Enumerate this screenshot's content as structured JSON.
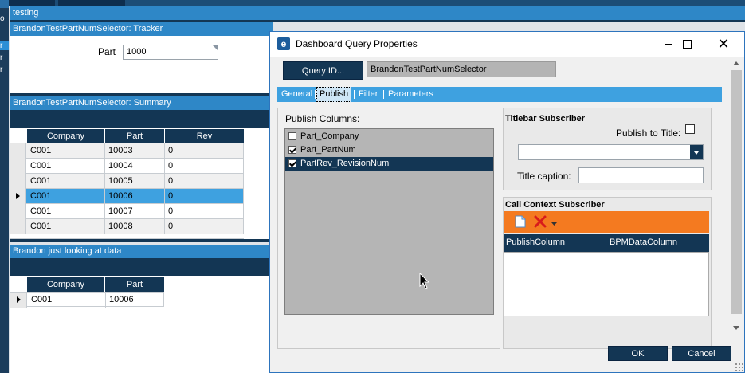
{
  "left_rail": {
    "letters": [
      "o",
      "r",
      "r",
      "r"
    ]
  },
  "panels": {
    "testing_header": "testing",
    "tracker": {
      "header": "BrandonTestPartNumSelector: Tracker",
      "part_label": "Part",
      "part_value": "1000"
    },
    "summary": {
      "header": "BrandonTestPartNumSelector: Summary",
      "columns": [
        "Company",
        "Part",
        "Rev"
      ],
      "rows": [
        [
          "C001",
          "10003",
          "0"
        ],
        [
          "C001",
          "10004",
          "0"
        ],
        [
          "C001",
          "10005",
          "0"
        ],
        [
          "C001",
          "10006",
          "0"
        ],
        [
          "C001",
          "10007",
          "0"
        ],
        [
          "C001",
          "10008",
          "0"
        ]
      ],
      "selected_row": 3
    },
    "looking": {
      "header": "Brandon just looking at data",
      "columns": [
        "Company",
        "Part"
      ],
      "rows": [
        [
          "C001",
          "10006"
        ]
      ]
    }
  },
  "dialog": {
    "title": "Dashboard Query Properties",
    "query_id_button": "Query ID...",
    "query_id_value": "BrandonTestPartNumSelector",
    "tabs": [
      "General",
      "Publish",
      "Filter",
      "Parameters"
    ],
    "active_tab": "Publish",
    "publish_columns_label": "Publish Columns:",
    "publish_columns": [
      {
        "label": "Part_Company",
        "checked": false,
        "selected": false
      },
      {
        "label": "Part_PartNum",
        "checked": true,
        "selected": false
      },
      {
        "label": "PartRev_RevisionNum",
        "checked": true,
        "selected": true
      }
    ],
    "titlebar_subscriber": {
      "title": "Titlebar Subscriber",
      "publish_to_title_label": "Publish to Title:",
      "publish_to_title_checked": false,
      "dropdown_value": "",
      "caption_label": "Title caption:",
      "caption_value": ""
    },
    "call_context": {
      "title": "Call Context Subscriber",
      "columns": [
        "PublishColumn",
        "BPMDataColumn"
      ]
    },
    "ok_label": "OK",
    "cancel_label": "Cancel"
  },
  "colors": {
    "accent": "#2e87c7",
    "dark": "#133654",
    "selection": "#3ea1e0",
    "orange": "#f47a20"
  }
}
